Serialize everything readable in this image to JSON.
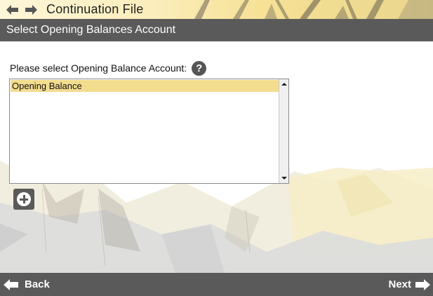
{
  "window": {
    "title": "Continuation File",
    "back_arrow_icon": "arrow-left-icon",
    "forward_arrow_icon": "arrow-right-icon"
  },
  "section": {
    "header": "Select Opening Balances Account"
  },
  "form": {
    "prompt": "Please select Opening Balance Account:",
    "help_glyph": "?",
    "accounts": [
      {
        "label": "Opening Balance",
        "selected": true
      }
    ],
    "add_button_icon": "plus-circle-icon"
  },
  "footer": {
    "back_label": "Back",
    "next_label": "Next"
  },
  "colors": {
    "header_bar": "#5a5a5a",
    "selection": "#f2dc8e",
    "title_gradient_end": "#e9d68c"
  }
}
